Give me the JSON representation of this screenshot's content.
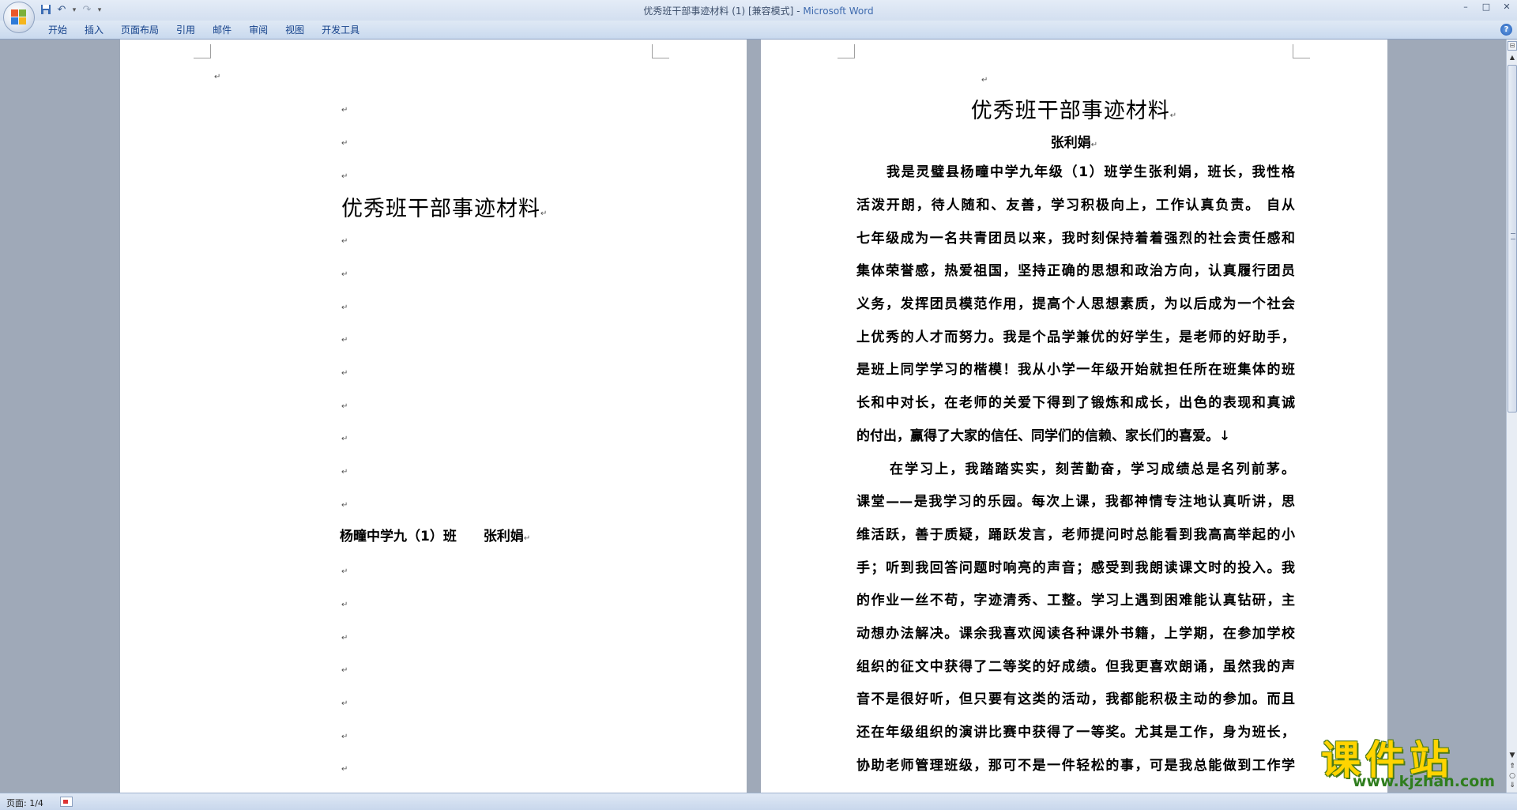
{
  "window": {
    "title": "优秀班干部事迹材料 (1) [兼容模式]",
    "title_sep": " - ",
    "app_name": "Microsoft Word",
    "controls": [
      "–",
      "□",
      "✕"
    ]
  },
  "qat": {
    "save_icon": "save-icon",
    "undo_icon": "undo-icon",
    "redo_icon": "redo-icon",
    "customize_icon": "customize-qat-icon"
  },
  "ribbon": {
    "tabs": [
      "开始",
      "插入",
      "页面布局",
      "引用",
      "邮件",
      "审阅",
      "视图",
      "开发工具"
    ],
    "help": "?"
  },
  "page1": {
    "title": "优秀班干部事迹材料",
    "byline": "杨疃中学九（1）班　　张利娟",
    "para_mark": "↵"
  },
  "page2": {
    "title": "优秀班干部事迹材料",
    "author": "张利娟",
    "lines": [
      "我是灵璧县杨疃中学九年级（1）班学生张利娟，班长，我性格",
      "活泼开朗，待人随和、友善，学习积极向上，工作认真负责。 自从",
      "七年级成为一名共青团员以来，我时刻保持着着强烈的社会责任感和",
      "集体荣誉感，热爱祖国，坚持正确的思想和政治方向，认真履行团员",
      "义务，发挥团员模范作用，提高个人思想素质，为以后成为一个社会",
      "上优秀的人才而努力。我是个品学兼优的好学生，是老师的好助手，",
      "是班上同学学习的楷模！我从小学一年级开始就担任所在班集体的班",
      "长和中对长，在老师的关爱下得到了锻炼和成长，出色的表现和真诚",
      "的付出，赢得了大家的信任、同学们的信赖、家长们的喜爱。↓",
      "在学习上，我踏踏实实，刻苦勤奋，学习成绩总是名列前茅。",
      "课堂——是我学习的乐园。每次上课，我都神情专注地认真听讲，思",
      "维活跃，善于质疑，踊跃发言，老师提问时总能看到我高高举起的小",
      "手；听到我回答问题时响亮的声音；感受到我朗读课文时的投入。我",
      "的作业一丝不苟，字迹清秀、工整。学习上遇到困难能认真钻研，主",
      "动想办法解决。课余我喜欢阅读各种课外书籍，上学期，在参加学校",
      "组织的征文中获得了二等奖的好成绩。但我更喜欢朗诵，虽然我的声",
      "音不是很好听，但只要有这类的活动，我都能积极主动的参加。而且",
      "还在年级组织的演讲比赛中获得了一等奖。尤其是工作，身为班长，",
      "协助老师管理班级，那可不是一件轻松的事，可是我总能做到工作学"
    ]
  },
  "status": {
    "page": "页面: 1/4"
  },
  "watermark": {
    "main": "课件站",
    "sub": "www.kjzhan.com"
  },
  "colors": {
    "accent": "#15428b",
    "app_name": "#3e6aae",
    "watermark_yellow": "#ffd400",
    "watermark_green": "#2f7d1e"
  }
}
